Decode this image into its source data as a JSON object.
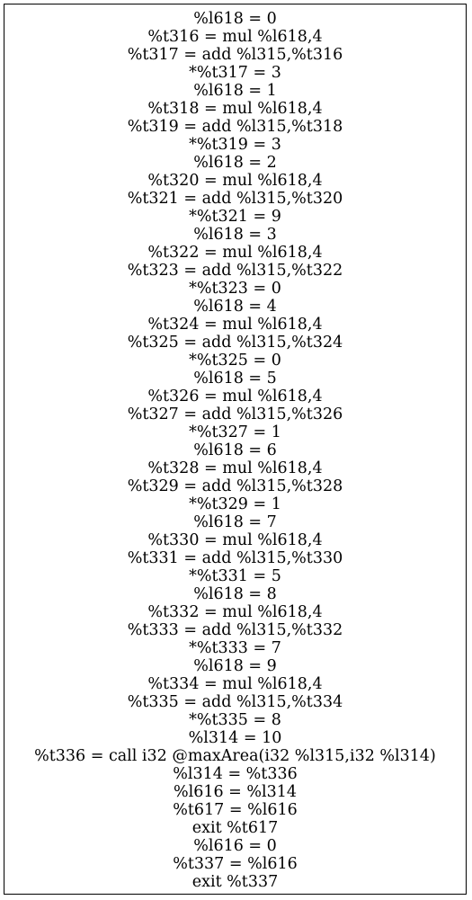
{
  "node": {
    "lines": [
      "%l618 = 0",
      "%t316 = mul %l618,4",
      "%t317 = add %l315,%t316",
      "*%t317 = 3",
      "%l618 = 1",
      "%t318 = mul %l618,4",
      "%t319 = add %l315,%t318",
      "*%t319 = 3",
      "%l618 = 2",
      "%t320 = mul %l618,4",
      "%t321 = add %l315,%t320",
      "*%t321 = 9",
      "%l618 = 3",
      "%t322 = mul %l618,4",
      "%t323 = add %l315,%t322",
      "*%t323 = 0",
      "%l618 = 4",
      "%t324 = mul %l618,4",
      "%t325 = add %l315,%t324",
      "*%t325 = 0",
      "%l618 = 5",
      "%t326 = mul %l618,4",
      "%t327 = add %l315,%t326",
      "*%t327 = 1",
      "%l618 = 6",
      "%t328 = mul %l618,4",
      "%t329 = add %l315,%t328",
      "*%t329 = 1",
      "%l618 = 7",
      "%t330 = mul %l618,4",
      "%t331 = add %l315,%t330",
      "*%t331 = 5",
      "%l618 = 8",
      "%t332 = mul %l618,4",
      "%t333 = add %l315,%t332",
      "*%t333 = 7",
      "%l618 = 9",
      "%t334 = mul %l618,4",
      "%t335 = add %l315,%t334",
      "*%t335 = 8",
      "%l314 = 10",
      "%t336 = call i32 @maxArea(i32 %l315,i32 %l314)",
      "%l314 = %t336",
      "%l616 = %l314",
      "%t617 = %l616",
      "exit %t617",
      "%l616 = 0",
      "%t337 = %l616",
      "exit %t337"
    ]
  }
}
